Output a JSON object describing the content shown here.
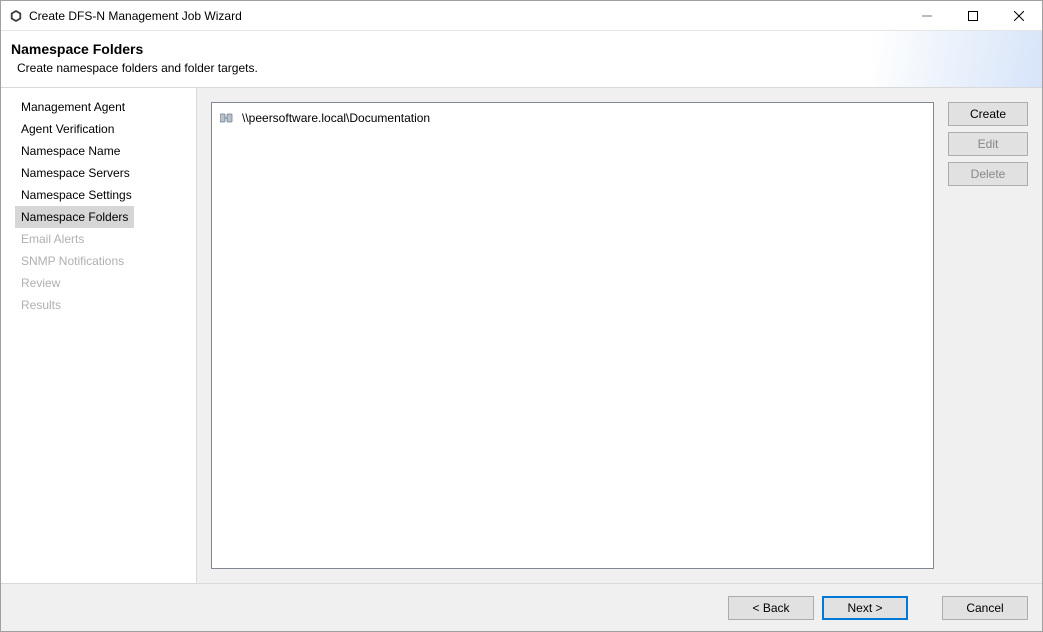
{
  "titlebar": {
    "title": "Create DFS-N Management Job Wizard"
  },
  "header": {
    "heading": "Namespace Folders",
    "subheading": "Create namespace folders and folder targets."
  },
  "sidebar": {
    "items": [
      {
        "label": "Management Agent",
        "state": "normal"
      },
      {
        "label": "Agent Verification",
        "state": "normal"
      },
      {
        "label": "Namespace Name",
        "state": "normal"
      },
      {
        "label": "Namespace Servers",
        "state": "normal"
      },
      {
        "label": "Namespace Settings",
        "state": "normal"
      },
      {
        "label": "Namespace Folders",
        "state": "selected"
      },
      {
        "label": "Email Alerts",
        "state": "disabled"
      },
      {
        "label": "SNMP Notifications",
        "state": "disabled"
      },
      {
        "label": "Review",
        "state": "disabled"
      },
      {
        "label": "Results",
        "state": "disabled"
      }
    ]
  },
  "tree": {
    "items": [
      {
        "label": "\\\\peersoftware.local\\Documentation"
      }
    ]
  },
  "actions": {
    "create": "Create",
    "edit": "Edit",
    "delete": "Delete"
  },
  "footer": {
    "back": "< Back",
    "next": "Next >",
    "cancel": "Cancel"
  }
}
